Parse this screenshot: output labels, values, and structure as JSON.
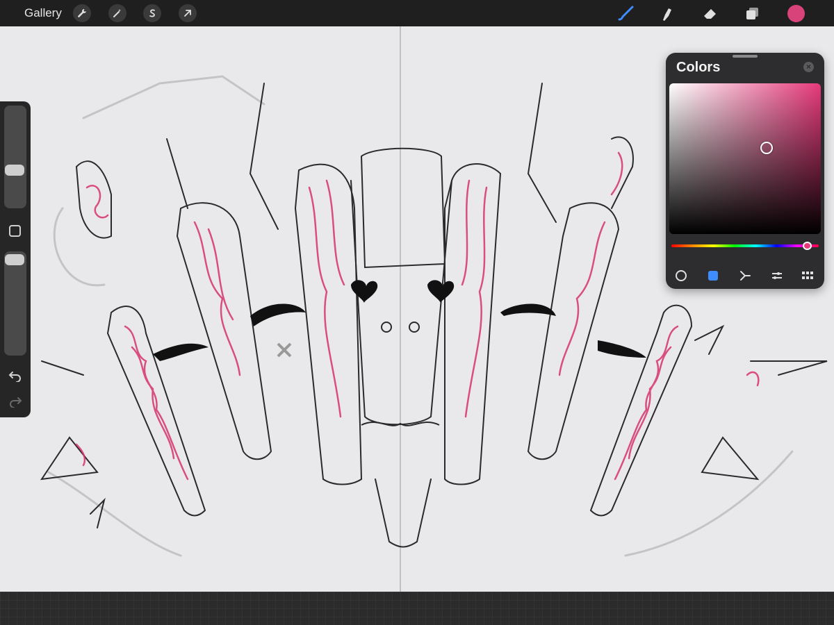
{
  "topbar": {
    "gallery_label": "Gallery",
    "left_tools": [
      "wrench-icon",
      "magic-wand-icon",
      "selection-s-icon",
      "transform-arrow-icon"
    ],
    "right_tools": [
      "brush-icon",
      "smudge-icon",
      "eraser-icon",
      "layers-icon"
    ],
    "current_color": "#d8437a"
  },
  "sidebar": {
    "controls": [
      "brush-size-slider",
      "modify-button",
      "opacity-slider",
      "undo-icon",
      "redo-icon"
    ]
  },
  "colors_panel": {
    "title": "Colors",
    "selected_color": "#e63a7a",
    "modes": [
      "disc-mode",
      "classic-mode",
      "harmony-mode",
      "value-mode",
      "palettes-mode"
    ],
    "active_mode": "classic-mode"
  },
  "canvas": {
    "accent_pink": "#d6336c",
    "line_color": "#1a1a1a"
  }
}
